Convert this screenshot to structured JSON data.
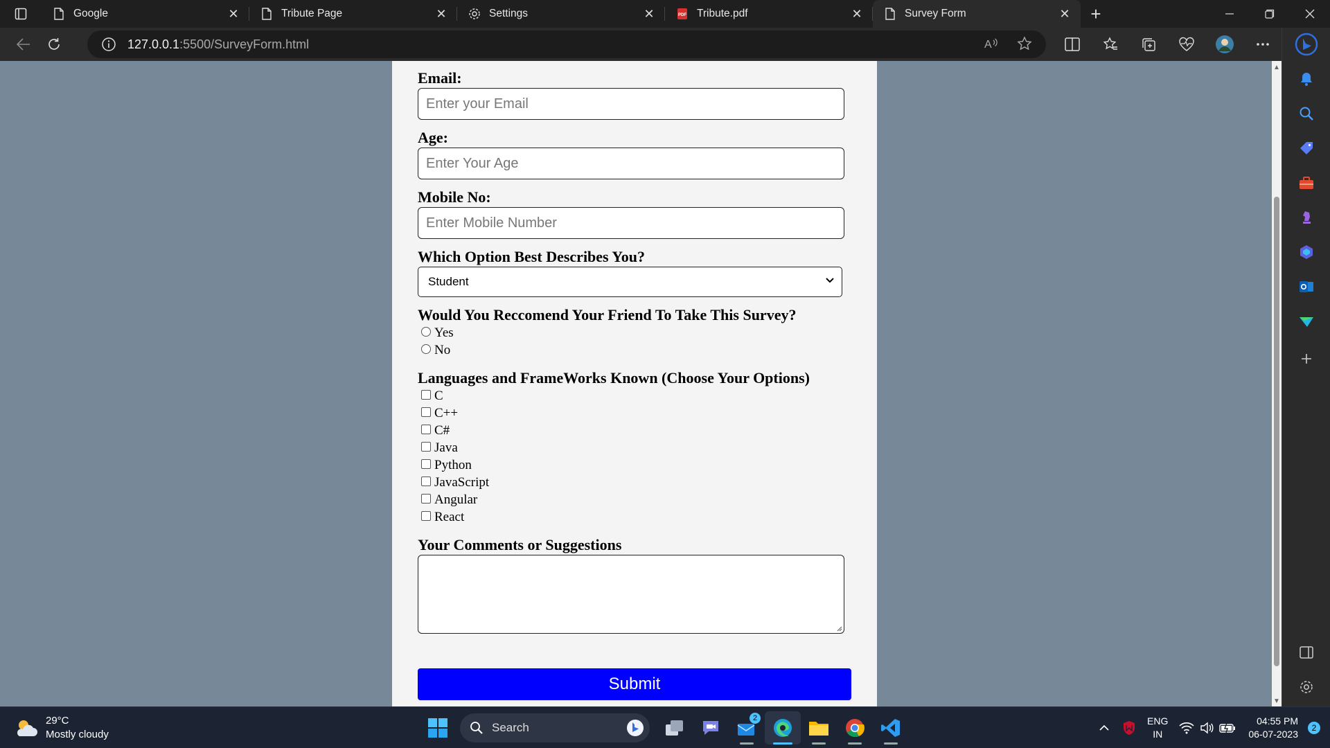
{
  "browser": {
    "tabs": [
      {
        "label": "Google",
        "icon": "page-icon"
      },
      {
        "label": "Tribute Page",
        "icon": "page-icon"
      },
      {
        "label": "Settings",
        "icon": "gear-icon"
      },
      {
        "label": "Tribute.pdf",
        "icon": "pdf-icon"
      },
      {
        "label": "Survey Form",
        "icon": "page-icon",
        "active": true
      }
    ],
    "url_host": "127.0.0.1",
    "url_path": ":5500/SurveyForm.html"
  },
  "form": {
    "email_label": "Email:",
    "email_placeholder": "Enter your Email",
    "age_label": "Age:",
    "age_placeholder": "Enter Your Age",
    "mobile_label": "Mobile No:",
    "mobile_placeholder": "Enter Mobile Number",
    "role_label": "Which Option Best Describes You?",
    "role_selected": "Student",
    "recommend_label": "Would You Reccomend Your Friend To Take This Survey?",
    "recommend_options": [
      "Yes",
      "No"
    ],
    "languages_label": "Languages and FrameWorks Known (Choose Your Options)",
    "languages": [
      "C",
      "C++",
      "C#",
      "Java",
      "Python",
      "JavaScript",
      "Angular",
      "React"
    ],
    "comments_label": "Your Comments or Suggestions",
    "submit_label": "Submit",
    "colors": {
      "background": "#778899",
      "card": "#f4f4f4",
      "submit": "#0000ff"
    }
  },
  "taskbar": {
    "temperature": "29°C",
    "weather": "Mostly cloudy",
    "search_label": "Search",
    "mail_badge": "2",
    "lang_line1": "ENG",
    "lang_line2": "IN",
    "time": "04:55 PM",
    "date": "06-07-2023",
    "notification_count": "2"
  }
}
